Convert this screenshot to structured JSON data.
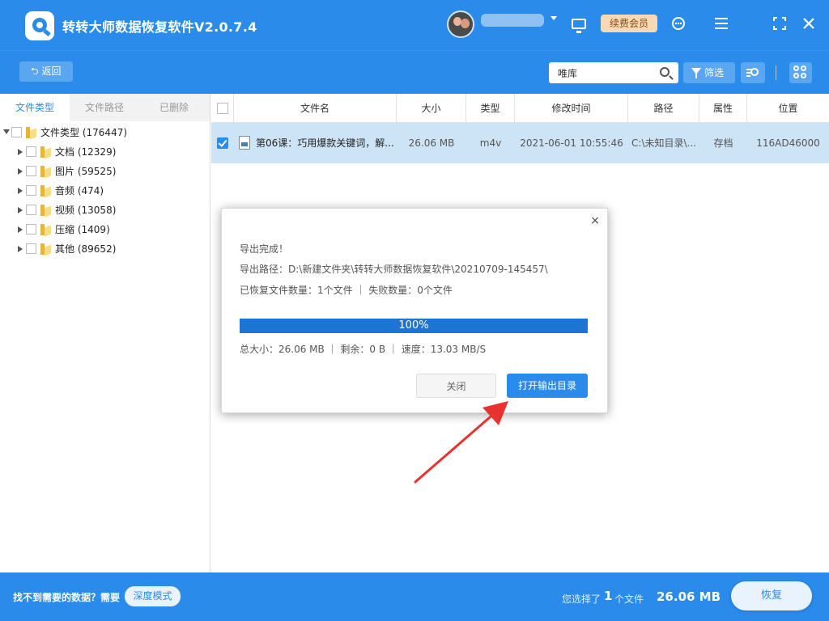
{
  "app": {
    "title": "转转大师数据恢复软件V2.0.7.4",
    "vip_label": "续费会员"
  },
  "toolbar": {
    "back_label": "返回",
    "search_value": "唯库",
    "filter_label": "筛选"
  },
  "left_tabs": [
    {
      "label": "文件类型"
    },
    {
      "label": "文件路径"
    },
    {
      "label": "已删除"
    }
  ],
  "tree": {
    "root": {
      "label": "文件类型",
      "count": "(176447)"
    },
    "children": [
      {
        "label": "文档",
        "count": "(12329)"
      },
      {
        "label": "图片",
        "count": "(59525)"
      },
      {
        "label": "音频",
        "count": "(474)"
      },
      {
        "label": "视频",
        "count": "(13058)"
      },
      {
        "label": "压缩",
        "count": "(1409)"
      },
      {
        "label": "其他",
        "count": "(89652)"
      }
    ]
  },
  "table": {
    "columns": [
      "文件名",
      "大小",
      "类型",
      "修改时间",
      "路径",
      "属性",
      "位置"
    ],
    "rows": [
      {
        "name": "第06课：巧用爆款关键词，解...",
        "size": "26.06 MB",
        "type": "m4v",
        "modified": "2021-06-01 10:55:46",
        "path": "C:\\未知目录\\...",
        "attr": "存档",
        "location": "116AD46000",
        "checked": true
      }
    ]
  },
  "dialog": {
    "close_glyph": "×",
    "title": "导出完成！",
    "path_line": "导出路径：D:\\新建文件夹\\转转大师数据恢复软件\\20210709-145457\\",
    "result_line": "已恢复文件数量：1个文件  ｜  失败数量：0个文件",
    "progress_percent": 100,
    "progress_label": "100%",
    "stats_line": "总大小：26.06 MB  ｜  剩余：0 B  ｜  速度：13.03 MB/S",
    "close_button": "关闭",
    "open_button": "打开输出目录"
  },
  "bottom": {
    "not_found": "找不到需要的数据？需要",
    "deep_mode": "深度模式",
    "selected_prefix": "您选择了",
    "selected_count": "1",
    "selected_unit": "个文件",
    "selected_size": "26.06 MB",
    "recover_label": "恢复"
  },
  "colors": {
    "brand": "#2a8bea",
    "progress": "#1e74d3",
    "row_selected": "#cde4f7",
    "vip_bg": "#f7d9b5",
    "arrow": "#e8322f"
  },
  "icons": [
    "app-logo-icon",
    "avatar",
    "monitor-icon",
    "customer-service-icon",
    "menu-icon",
    "maximize-icon",
    "close-icon",
    "back-icon",
    "search-icon",
    "filter-icon",
    "list-search-icon",
    "grid-view-icon",
    "folder-icon",
    "video-file-icon"
  ]
}
